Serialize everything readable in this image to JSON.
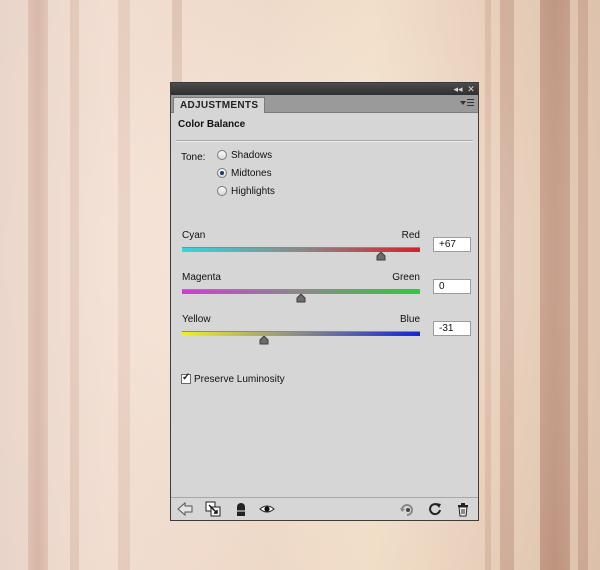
{
  "panel": {
    "tab_label": "ADJUSTMENTS",
    "heading": "Color Balance",
    "collapse_glyph": "◂◂",
    "close_glyph": "✕"
  },
  "tone": {
    "label": "Tone:",
    "options": [
      {
        "label": "Shadows",
        "selected": false
      },
      {
        "label": "Midtones",
        "selected": true
      },
      {
        "label": "Highlights",
        "selected": false
      }
    ]
  },
  "sliders": [
    {
      "left": "Cyan",
      "right": "Red",
      "value": "+67",
      "numeric": 67,
      "min": -100,
      "max": 100,
      "left_color": "#35d6dc",
      "right_color": "#d8202a"
    },
    {
      "left": "Magenta",
      "right": "Green",
      "value": "0",
      "numeric": 0,
      "min": -100,
      "max": 100,
      "left_color": "#d23ad6",
      "right_color": "#2dcc3a"
    },
    {
      "left": "Yellow",
      "right": "Blue",
      "value": "-31",
      "numeric": -31,
      "min": -100,
      "max": 100,
      "left_color": "#f2ee2a",
      "right_color": "#1226d8"
    }
  ],
  "preserve_luminosity": {
    "label": "Preserve Luminosity",
    "checked": true
  },
  "bottom_icons": [
    "back-arrow-icon",
    "clip-to-layer-icon",
    "layer-mask-icon",
    "visibility-eye-icon",
    "previous-state-icon",
    "reset-icon",
    "trash-icon"
  ],
  "colors": {
    "panel_bg": "#d6d6d6",
    "title_bar": "#3a3a3a",
    "tab_row": "#9a9a9a"
  }
}
